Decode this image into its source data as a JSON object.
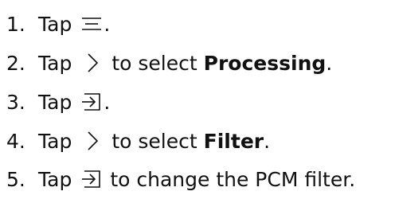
{
  "steps": [
    {
      "number": "1.",
      "tap": "Tap",
      "icon": "menu-icon",
      "after": "."
    },
    {
      "number": "2.",
      "tap": "Tap",
      "icon": "chevron-right-icon",
      "after": "to select",
      "bold": "Processing",
      "end": "."
    },
    {
      "number": "3.",
      "tap": "Tap",
      "icon": "enter-icon",
      "after": "."
    },
    {
      "number": "4.",
      "tap": "Tap",
      "icon": "chevron-right-icon",
      "after": "to select",
      "bold": "Filter",
      "end": "."
    },
    {
      "number": "5.",
      "tap": "Tap",
      "icon": "enter-icon",
      "after": "to change the PCM filter."
    }
  ]
}
